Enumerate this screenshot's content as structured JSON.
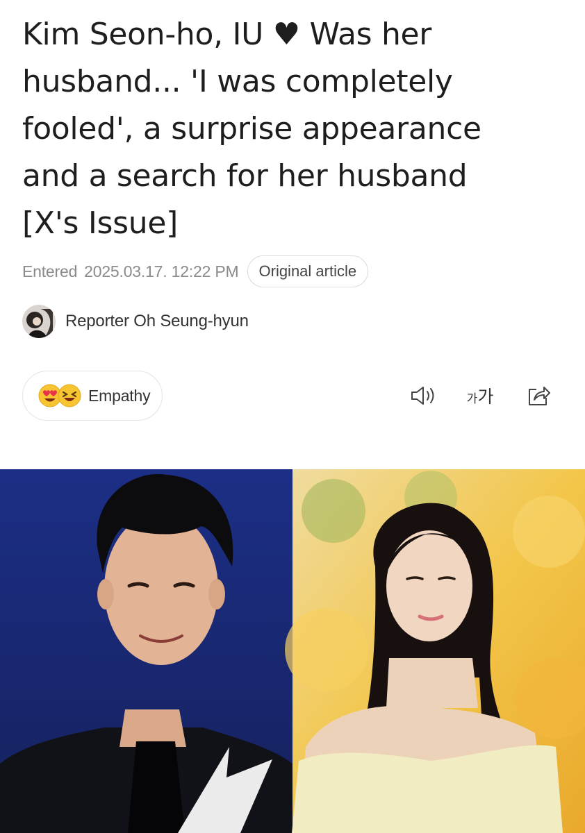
{
  "article": {
    "headline_lines": [
      "Kim Seon-ho, IU ♥ Was her",
      "husband... 'I was completely",
      "fooled', a surprise appearance",
      "and a search for her husband",
      "[X's Issue]"
    ],
    "entered_label": "Entered",
    "entered_datetime": "2025.03.17. 12:22 PM",
    "original_article_label": "Original article",
    "reporter_name": "Reporter Oh Seung-hyun"
  },
  "actions": {
    "empathy_label": "Empathy",
    "font_small_glyph": "가",
    "font_large_glyph": "가",
    "icons": [
      "emoji-heart-eyes",
      "emoji-laughing",
      "speaker-icon",
      "font-size-icon",
      "share-icon"
    ]
  },
  "colors": {
    "text": "#1e1e1e",
    "meta": "#8a8a8a",
    "border": "#dcdcdc",
    "emoji_yellow": "#f7c531",
    "emoji_heart": "#e8314a"
  }
}
